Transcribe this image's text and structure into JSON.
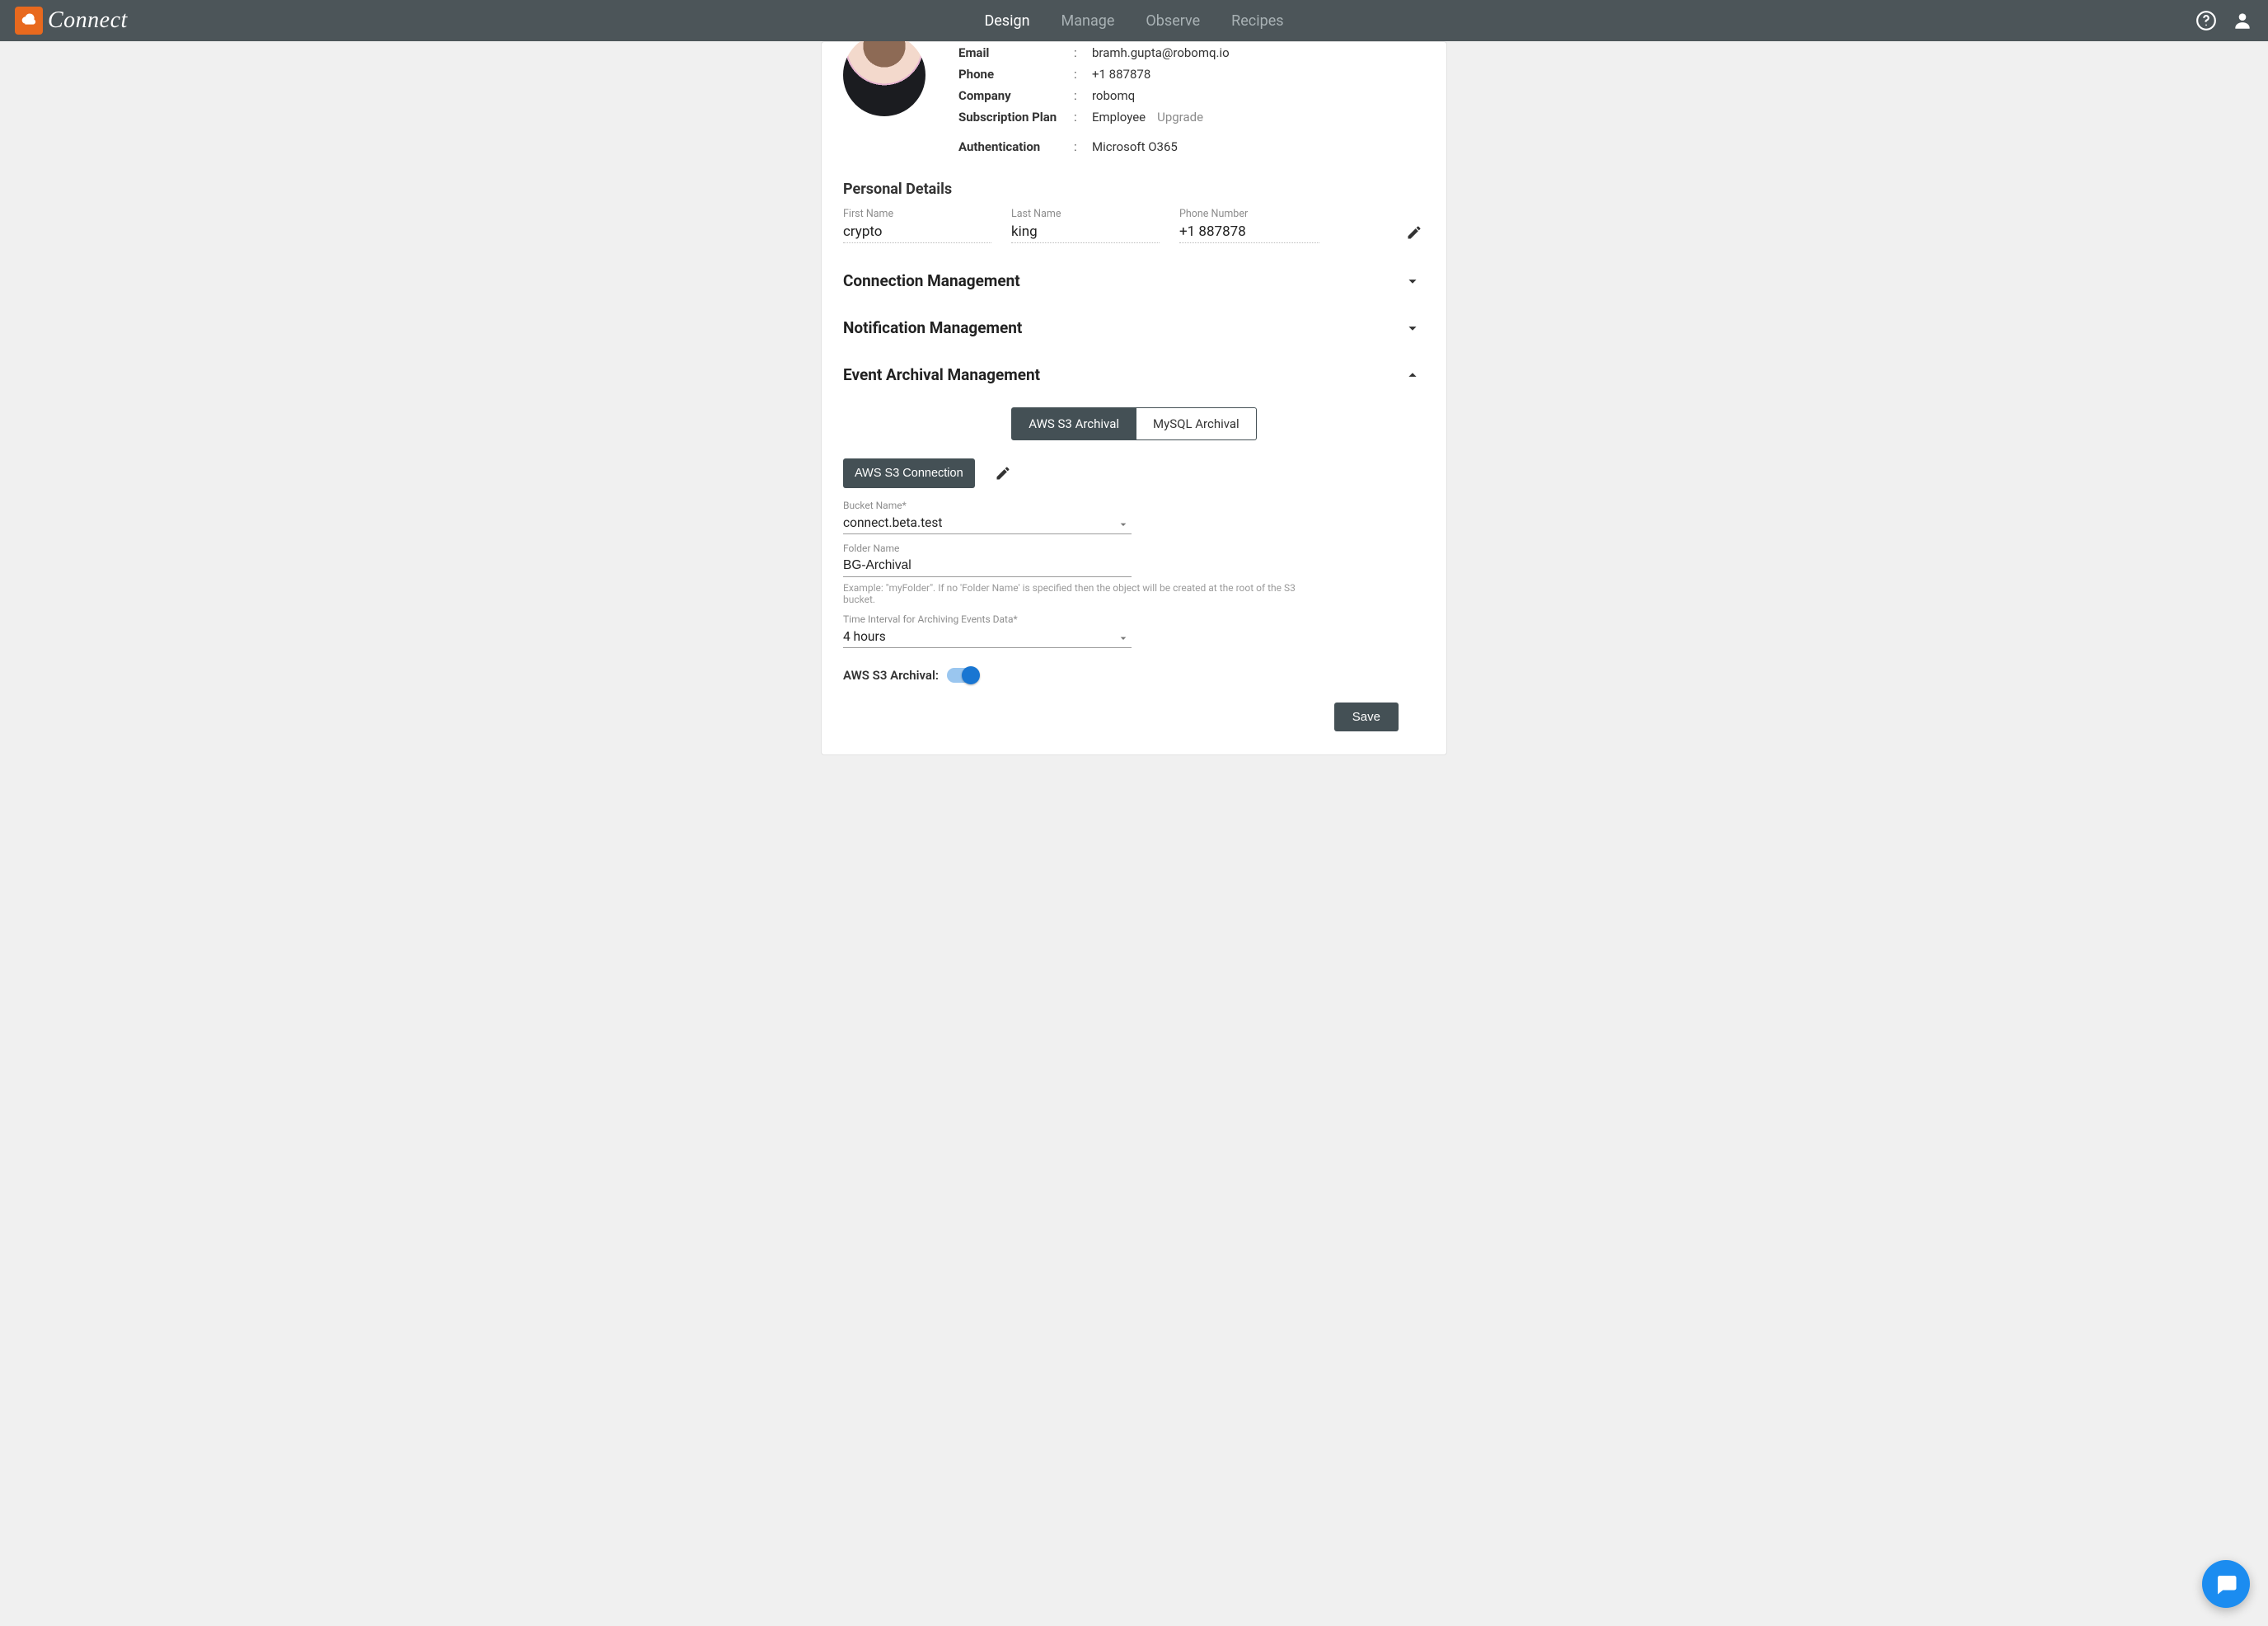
{
  "brand": {
    "name": "Connect"
  },
  "nav": {
    "items": [
      {
        "label": "Design",
        "active": true
      },
      {
        "label": "Manage",
        "active": false
      },
      {
        "label": "Observe",
        "active": false
      },
      {
        "label": "Recipes",
        "active": false
      }
    ]
  },
  "profile": {
    "email_label": "Email",
    "email": "bramh.gupta@robomq.io",
    "phone_label": "Phone",
    "phone": "+1 887878",
    "company_label": "Company",
    "company": "robomq",
    "plan_label": "Subscription Plan",
    "plan": "Employee",
    "upgrade_label": "Upgrade",
    "auth_label": "Authentication",
    "auth": "Microsoft O365"
  },
  "personal": {
    "title": "Personal Details",
    "first_name_label": "First Name",
    "first_name": "crypto",
    "last_name_label": "Last Name",
    "last_name": "king",
    "phone_label": "Phone Number",
    "phone": "+1 887878"
  },
  "sections": {
    "connection": "Connection Management",
    "notification": "Notification Management",
    "archival": "Event Archival Management"
  },
  "archival": {
    "tabs": [
      {
        "label": "AWS S3 Archival",
        "active": true
      },
      {
        "label": "MySQL Archival",
        "active": false
      }
    ],
    "connection_btn": "AWS S3 Connection",
    "bucket_label": "Bucket Name*",
    "bucket_value": "connect.beta.test",
    "folder_label": "Folder Name",
    "folder_value": "BG-Archival",
    "folder_hint": "Example: \"myFolder\". If no 'Folder Name' is specified then the object will be created at the root of the S3 bucket.",
    "interval_label": "Time Interval for Archiving Events Data*",
    "interval_value": "4 hours",
    "toggle_label": "AWS S3 Archival:",
    "save_label": "Save"
  }
}
